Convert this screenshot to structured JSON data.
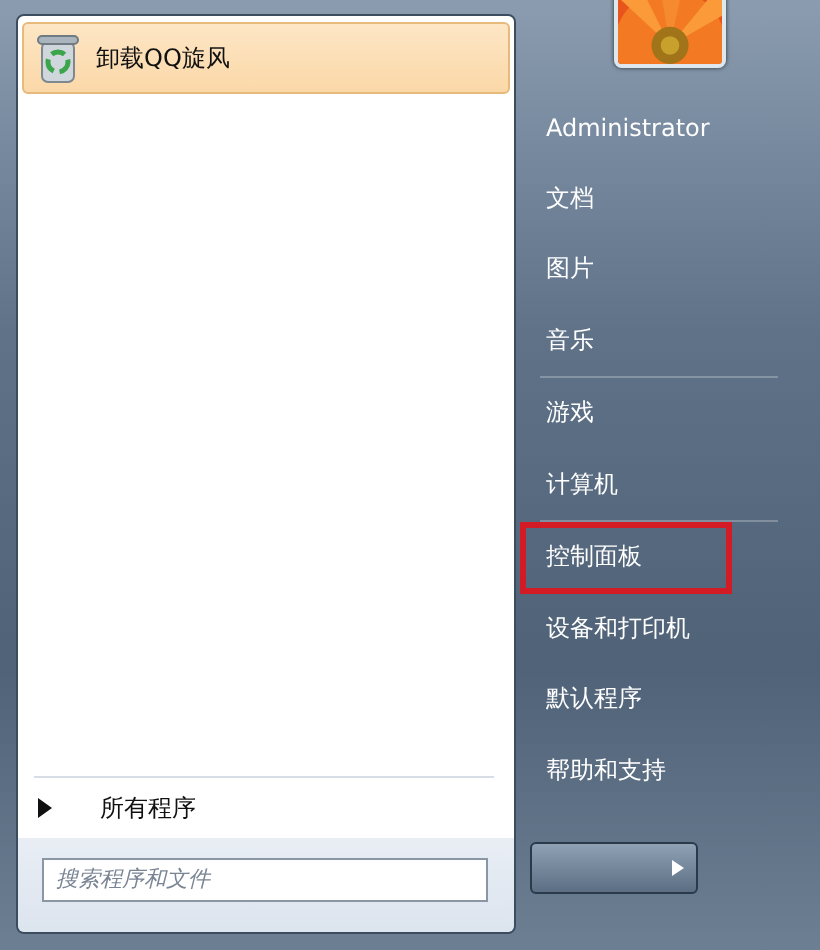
{
  "pinned_programs": [
    {
      "label": "卸载QQ旋风",
      "selected": true
    }
  ],
  "all_programs": {
    "label": "所有程序"
  },
  "search": {
    "placeholder": "搜索程序和文件"
  },
  "places": [
    {
      "kind": "item",
      "label": "Administrator",
      "marked": false
    },
    {
      "kind": "item",
      "label": "文档",
      "marked": false
    },
    {
      "kind": "item",
      "label": "图片",
      "marked": false
    },
    {
      "kind": "item",
      "label": "音乐",
      "marked": false
    },
    {
      "kind": "separator"
    },
    {
      "kind": "item",
      "label": "游戏",
      "marked": false
    },
    {
      "kind": "item",
      "label": "计算机",
      "marked": false
    },
    {
      "kind": "separator"
    },
    {
      "kind": "item",
      "label": "控制面板",
      "marked": true
    },
    {
      "kind": "item",
      "label": "设备和打印机",
      "marked": false
    },
    {
      "kind": "item",
      "label": "默认程序",
      "marked": false
    },
    {
      "kind": "item",
      "label": "帮助和支持",
      "marked": false
    }
  ]
}
